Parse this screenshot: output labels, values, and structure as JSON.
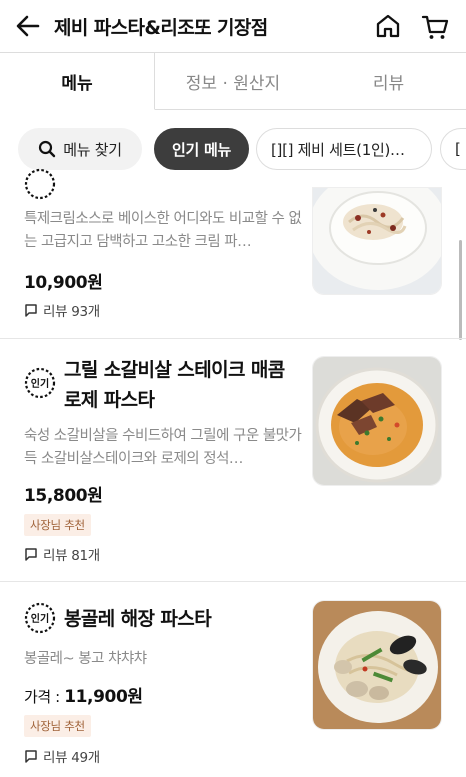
{
  "header": {
    "title": "제비 파스타&리조또 기장점"
  },
  "tabs": [
    {
      "label": "메뉴",
      "active": true
    },
    {
      "label": "정보 · 원산지",
      "active": false
    },
    {
      "label": "리뷰",
      "active": false
    }
  ],
  "chips": {
    "search": "메뉴 찾기",
    "popular": "인기 메뉴",
    "set": "[][] 제비 세트(1인)…",
    "more": "[ "
  },
  "popular_icon_text": "인기",
  "items": [
    {
      "name": "",
      "desc": "특제크림소스로 베이스한 어디와도 비교할 수 없는 고급지고 담백하고 고소한 크림 파…",
      "price_prefix": "",
      "price": "10,900원",
      "badge": "",
      "review": "리뷰 93개"
    },
    {
      "name": "그릴 소갈비살 스테이크 매콤 로제 파스타",
      "desc": "숙성 소갈비살을 수비드하여 그릴에 구운 불맛가득 소갈비살스테이크와 로제의 정석…",
      "price_prefix": "",
      "price": "15,800원",
      "badge": "사장님 추천",
      "review": "리뷰 81개"
    },
    {
      "name": "봉골레 해장 파스타",
      "desc": "봉골레~ 봉고 챠챠챠",
      "price_prefix": "가격 : ",
      "price": "11,900원",
      "badge": "사장님 추천",
      "review": "리뷰 49개"
    }
  ],
  "colors": {
    "accent_dark": "#3d3d3d",
    "badge_bg": "#fbeee6",
    "badge_text": "#a0633a"
  }
}
